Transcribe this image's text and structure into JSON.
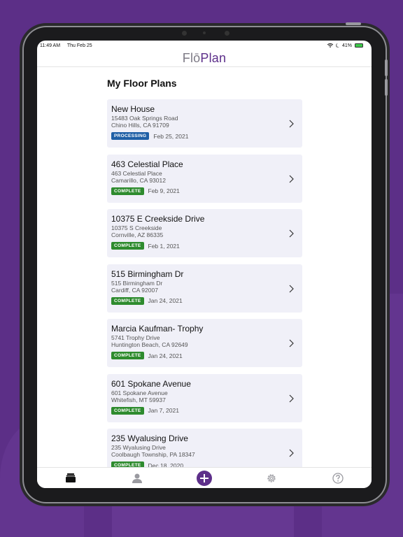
{
  "status_bar": {
    "time": "11:49 AM",
    "date": "Thu Feb 25",
    "battery": "41%"
  },
  "header": {
    "logo_part1": "Flō",
    "logo_part2": "Plan"
  },
  "page_title": "My Floor Plans",
  "floor_plans": [
    {
      "name": "New House",
      "address1": "15483 Oak Springs Road",
      "address2": "Chino Hills, CA 91709",
      "status": "PROCESSING",
      "date": "Feb 25, 2021"
    },
    {
      "name": "463 Celestial Place",
      "address1": "463 Celestial Place",
      "address2": "Camarillo, CA 93012",
      "status": "COMPLETE",
      "date": "Feb 9, 2021"
    },
    {
      "name": "10375 E Creekside Drive",
      "address1": "10375 S Creekside",
      "address2": "Cornville, AZ 86335",
      "status": "COMPLETE",
      "date": "Feb 1, 2021"
    },
    {
      "name": "515 Birmingham Dr",
      "address1": "515 Birmingham Dr",
      "address2": "Cardiff, CA 92007",
      "status": "COMPLETE",
      "date": "Jan 24, 2021"
    },
    {
      "name": "Marcia Kaufman- Trophy",
      "address1": "5741 Trophy Drive",
      "address2": "Huntington Beach, CA 92649",
      "status": "COMPLETE",
      "date": "Jan 24, 2021"
    },
    {
      "name": "601 Spokane Avenue",
      "address1": "601 Spokane Avenue",
      "address2": "Whitefish, MT 59937",
      "status": "COMPLETE",
      "date": "Jan 7, 2021"
    },
    {
      "name": "235 Wyalusing Drive",
      "address1": "235 Wyalusing Drive",
      "address2": "Coolbaugh Township, PA 18347",
      "status": "COMPLETE",
      "date": "Dec 18, 2020"
    }
  ],
  "colors": {
    "brand_purple": "#5d2f8a",
    "processing_blue": "#1f5fa6",
    "complete_green": "#2e8b2e",
    "card_bg": "#f0f0f8"
  },
  "tabs": [
    {
      "icon": "floor-plans-icon"
    },
    {
      "icon": "profile-icon"
    },
    {
      "icon": "add-icon"
    },
    {
      "icon": "settings-icon"
    },
    {
      "icon": "help-icon"
    }
  ]
}
